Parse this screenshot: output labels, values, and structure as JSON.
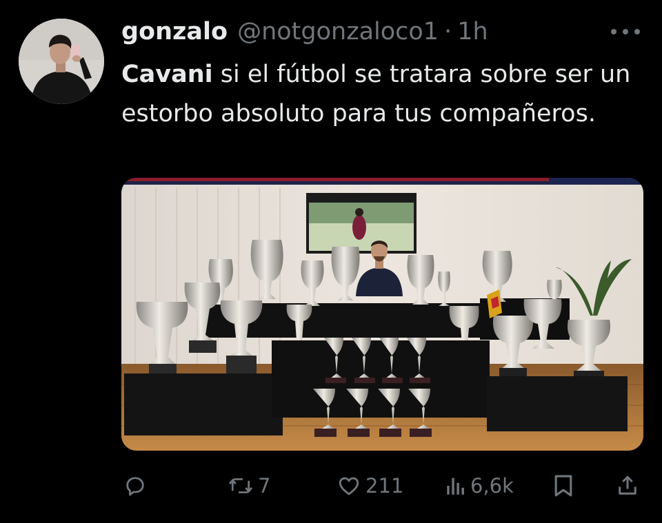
{
  "author": {
    "display_name": "gonzalo",
    "handle": "@notgonzaloco1",
    "separator": "·",
    "time": "1h"
  },
  "tweet": {
    "mention": "Cavani",
    "body": " si el fútbol se tratara sobre ser un estorbo absoluto para tus compañeros."
  },
  "media": {
    "description_icon": "trophy-room-photo"
  },
  "actions": {
    "reply": {
      "icon": "reply-icon",
      "count": ""
    },
    "retweet": {
      "icon": "retweet-icon",
      "count": "7"
    },
    "like": {
      "icon": "heart-icon",
      "count": "211"
    },
    "views": {
      "icon": "views-icon",
      "count": "6,6k"
    },
    "bookmark": {
      "icon": "bookmark-icon"
    },
    "share": {
      "icon": "share-icon"
    }
  },
  "colors": {
    "background": "#000000",
    "primary_text": "#e7e9ea",
    "secondary_text": "#71767b"
  }
}
